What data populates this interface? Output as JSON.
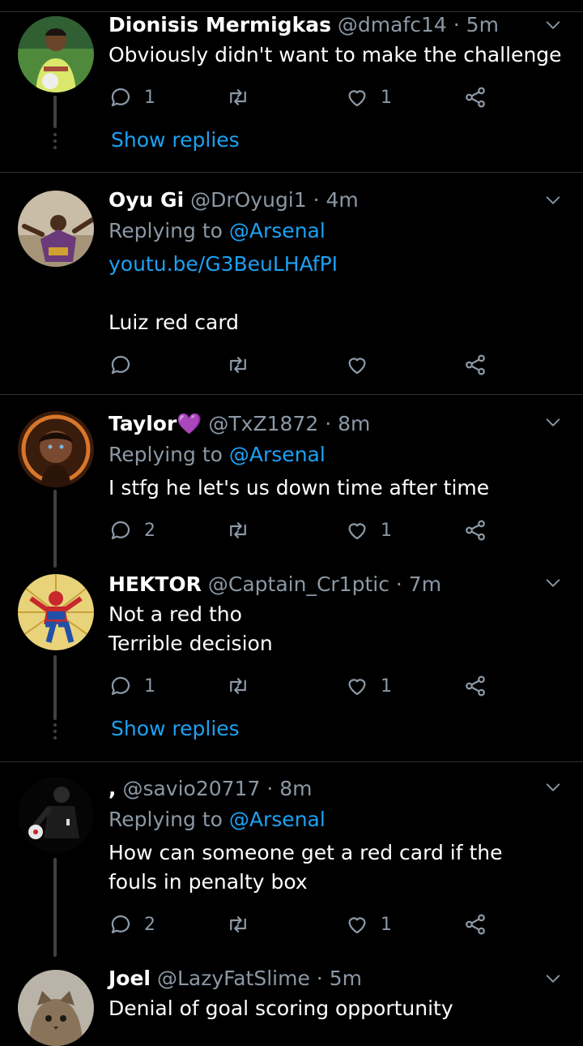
{
  "tweets": [
    {
      "name": "Dionisis Mermigkas",
      "handle": "@dmafc14",
      "time": "· 5m",
      "text": "Obviously didn't want to make the challenge",
      "reply_count": "1",
      "like_count": "1",
      "show_replies": "Show replies"
    },
    {
      "name": "Oyu Gi",
      "handle": "@DrOyugi1",
      "time": "· 4m",
      "replying_prefix": "Replying to",
      "replying_to": "@Arsenal",
      "link": "youtu.be/G3BeuLHAfPI",
      "text": "Luiz red card"
    },
    {
      "name": "Taylor",
      "name_emoji": "💜",
      "handle": "@TxZ1872",
      "time": "· 8m",
      "replying_prefix": "Replying to",
      "replying_to": "@Arsenal",
      "text": "I stfg he let's us down time after time",
      "reply_count": "2",
      "like_count": "1"
    },
    {
      "name": "HEKTOR",
      "handle": "@Captain_Cr1ptic",
      "time": "· 7m",
      "text": "Not a red tho\nTerrible decision",
      "reply_count": "1",
      "like_count": "1",
      "show_replies": "Show replies"
    },
    {
      "name": ",",
      "handle": "@savio20717",
      "time": "· 8m",
      "replying_prefix": "Replying to",
      "replying_to": "@Arsenal",
      "text": "How can someone get a red card if the fouls in penalty box",
      "reply_count": "2",
      "like_count": "1"
    },
    {
      "name": "Joel",
      "handle": "@LazyFatSlime",
      "time": "· 5m",
      "text": "Denial of goal scoring opportunity"
    }
  ],
  "colors": {
    "background": "#000000",
    "accent": "#1da1f2",
    "muted": "#8b98a5",
    "divider": "#2f3336"
  }
}
